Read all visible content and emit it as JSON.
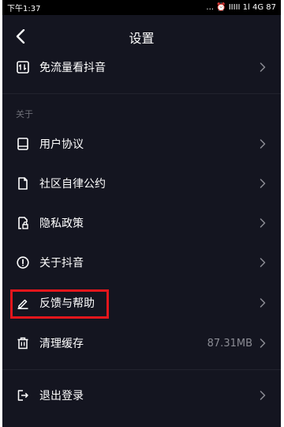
{
  "status_bar": {
    "time": "下午1:37",
    "indicators": "... ⏰ IIIII 1l 4G 87"
  },
  "header": {
    "title": "设置",
    "back_icon": "chevron-left-icon"
  },
  "sections": {
    "about_label": "关于"
  },
  "items": [
    {
      "label": "免流量看抖音",
      "icon": "data-saver-icon"
    },
    {
      "label": "用户协议",
      "icon": "book-icon"
    },
    {
      "label": "社区自律公约",
      "icon": "document-icon"
    },
    {
      "label": "隐私政策",
      "icon": "privacy-lock-icon"
    },
    {
      "label": "关于抖音",
      "icon": "info-icon"
    },
    {
      "label": "反馈与帮助",
      "icon": "pencil-icon"
    },
    {
      "label": "清理缓存",
      "icon": "trash-icon",
      "value": "87.31MB"
    },
    {
      "label": "退出登录",
      "icon": "logout-icon"
    }
  ],
  "colors": {
    "background": "#141520",
    "highlight_border": "#e3161c",
    "secondary_text": "#8a8b93"
  }
}
